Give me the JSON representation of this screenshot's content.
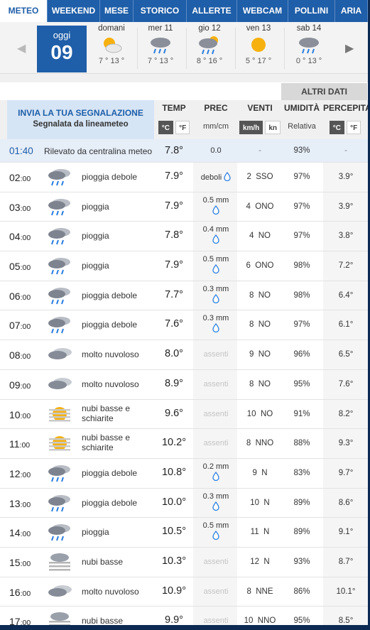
{
  "tabs": [
    {
      "label": "METEO",
      "active": true
    },
    {
      "label": "WEEKEND"
    },
    {
      "label": "MESE"
    },
    {
      "label": "STORICO"
    },
    {
      "label": "ALLERTE"
    },
    {
      "label": "WEBCAM"
    },
    {
      "label": "POLLINI"
    },
    {
      "label": "ARIA"
    }
  ],
  "today": {
    "label": "oggi",
    "number": "09"
  },
  "days": [
    {
      "name": "domani",
      "temps": "7 ° 13 °",
      "icon": "sun-cloud-icon"
    },
    {
      "name": "mer 11",
      "temps": "7 ° 13 °",
      "icon": "rain-icon"
    },
    {
      "name": "gio 12",
      "temps": "8 ° 16 °",
      "icon": "rain-sun-icon"
    },
    {
      "name": "ven 13",
      "temps": "5 ° 17 °",
      "icon": "sun-icon"
    },
    {
      "name": "sab 14",
      "temps": "0 ° 13 °",
      "icon": "rain-icon"
    }
  ],
  "header": {
    "altri_dati": "ALTRI DATI",
    "invia": "INVIA LA TUA SEGNALAZIONE",
    "segnalata": "Segnalata da lineameteo",
    "temp": "TEMP",
    "prec": "PREC",
    "venti": "VENTI",
    "umidita": "UMIDITÀ",
    "percepita": "PERCEPITA",
    "unit_c": "°C",
    "unit_f": "°F",
    "prec_unit": "mm/cm",
    "unit_kmh": "km/h",
    "unit_kn": "kn",
    "relativa": "Relativa",
    "unit_c2": "°C",
    "unit_f2": "°F"
  },
  "first_row": {
    "time": "01:40",
    "desc": "Rilevato da centralina meteo",
    "temp": "7.8°",
    "prec": "0.0",
    "wind": "-",
    "hum": "93%",
    "perc": "-"
  },
  "rows": [
    {
      "h": "02",
      "m": ":00",
      "icon": "rain",
      "desc": "pioggia debole",
      "temp": "7.9°",
      "prec": "deboli",
      "prec_type": "deboli",
      "wind": "2  SSO",
      "hum": "97%",
      "perc": "3.9°"
    },
    {
      "h": "03",
      "m": ":00",
      "icon": "rain",
      "desc": "pioggia",
      "temp": "7.9°",
      "prec": "0.5 mm",
      "prec_type": "mm",
      "wind": "4  ONO",
      "hum": "97%",
      "perc": "3.9°"
    },
    {
      "h": "04",
      "m": ":00",
      "icon": "rain",
      "desc": "pioggia",
      "temp": "7.8°",
      "prec": "0.4 mm",
      "prec_type": "mm",
      "wind": "4  NO",
      "hum": "97%",
      "perc": "3.8°"
    },
    {
      "h": "05",
      "m": ":00",
      "icon": "rain",
      "desc": "pioggia",
      "temp": "7.9°",
      "prec": "0.5 mm",
      "prec_type": "mm",
      "wind": "6  ONO",
      "hum": "98%",
      "perc": "7.2°"
    },
    {
      "h": "06",
      "m": ":00",
      "icon": "rain",
      "desc": "pioggia debole",
      "temp": "7.7°",
      "prec": "0.3 mm",
      "prec_type": "mm",
      "wind": "8  NO",
      "hum": "98%",
      "perc": "6.4°"
    },
    {
      "h": "07",
      "m": ":00",
      "icon": "rain",
      "desc": "pioggia debole",
      "temp": "7.6°",
      "prec": "0.3 mm",
      "prec_type": "mm",
      "wind": "8  NO",
      "hum": "97%",
      "perc": "6.1°"
    },
    {
      "h": "08",
      "m": ":00",
      "icon": "cloud",
      "desc": "molto nuvoloso",
      "temp": "8.0°",
      "prec": "assenti",
      "prec_type": "assenti",
      "wind": "9  NO",
      "hum": "96%",
      "perc": "6.5°"
    },
    {
      "h": "09",
      "m": ":00",
      "icon": "cloud",
      "desc": "molto nuvoloso",
      "temp": "8.9°",
      "prec": "assenti",
      "prec_type": "assenti",
      "wind": "8  NO",
      "hum": "95%",
      "perc": "7.6°"
    },
    {
      "h": "10",
      "m": ":00",
      "icon": "fog-sun",
      "desc": "nubi basse e schiarite",
      "temp": "9.6°",
      "prec": "assenti",
      "prec_type": "assenti",
      "wind": "10  NO",
      "hum": "91%",
      "perc": "8.2°"
    },
    {
      "h": "11",
      "m": ":00",
      "icon": "fog-sun",
      "desc": "nubi basse e schiarite",
      "temp": "10.2°",
      "prec": "assenti",
      "prec_type": "assenti",
      "wind": "8  NNO",
      "hum": "88%",
      "perc": "9.3°"
    },
    {
      "h": "12",
      "m": ":00",
      "icon": "rain",
      "desc": "pioggia debole",
      "temp": "10.8°",
      "prec": "0.2 mm",
      "prec_type": "mm",
      "wind": "9  N",
      "hum": "83%",
      "perc": "9.7°"
    },
    {
      "h": "13",
      "m": ":00",
      "icon": "rain",
      "desc": "pioggia debole",
      "temp": "10.0°",
      "prec": "0.3 mm",
      "prec_type": "mm",
      "wind": "10  N",
      "hum": "89%",
      "perc": "8.6°"
    },
    {
      "h": "14",
      "m": ":00",
      "icon": "rain",
      "desc": "pioggia",
      "temp": "10.5°",
      "prec": "0.5 mm",
      "prec_type": "mm",
      "wind": "11  N",
      "hum": "89%",
      "perc": "9.1°"
    },
    {
      "h": "15",
      "m": ":00",
      "icon": "fog",
      "desc": "nubi basse",
      "temp": "10.3°",
      "prec": "assenti",
      "prec_type": "assenti",
      "wind": "12  N",
      "hum": "93%",
      "perc": "8.7°"
    },
    {
      "h": "16",
      "m": ":00",
      "icon": "cloud",
      "desc": "molto nuvoloso",
      "temp": "10.9°",
      "prec": "assenti",
      "prec_type": "assenti",
      "wind": "8  NNE",
      "hum": "86%",
      "perc": "10.1°"
    },
    {
      "h": "17",
      "m": ":00",
      "icon": "fog",
      "desc": "nubi basse",
      "temp": "9.9°",
      "prec": "assenti",
      "prec_type": "assenti",
      "wind": "10  NNO",
      "hum": "95%",
      "perc": "8.5°"
    }
  ]
}
